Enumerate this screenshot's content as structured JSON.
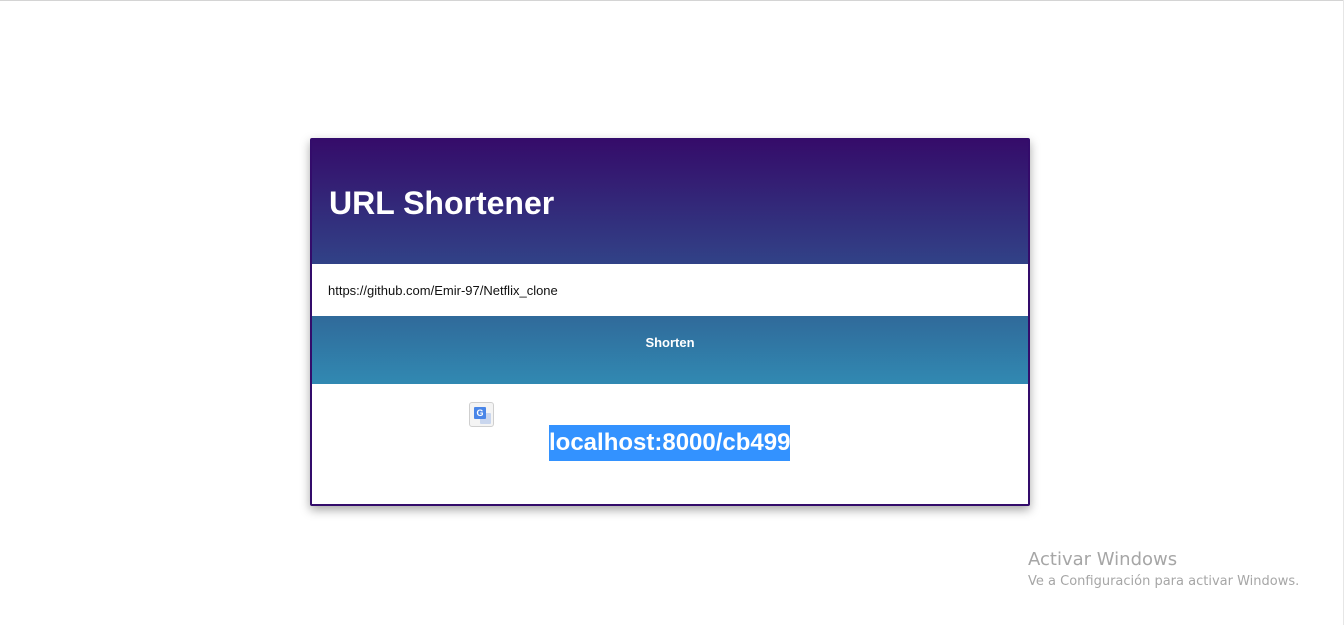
{
  "app": {
    "title": "URL Shortener"
  },
  "form": {
    "url_value": "https://github.com/Emir-97/Netflix_clone",
    "shorten_label": "Shorten"
  },
  "result": {
    "short_url": "localhost:8000/cb499"
  },
  "translate_icon": {
    "icon": "google-translate-icon",
    "glyph": "G"
  },
  "watermark": {
    "title": "Activar Windows",
    "subtitle": "Ve a Configuración para activar Windows."
  },
  "colors": {
    "header_start": "#350c6a",
    "header_end": "#314287",
    "button_start": "#306a9a",
    "button_end": "#3189b2",
    "selection": "#3392ff",
    "card_border": "#330c6b"
  }
}
